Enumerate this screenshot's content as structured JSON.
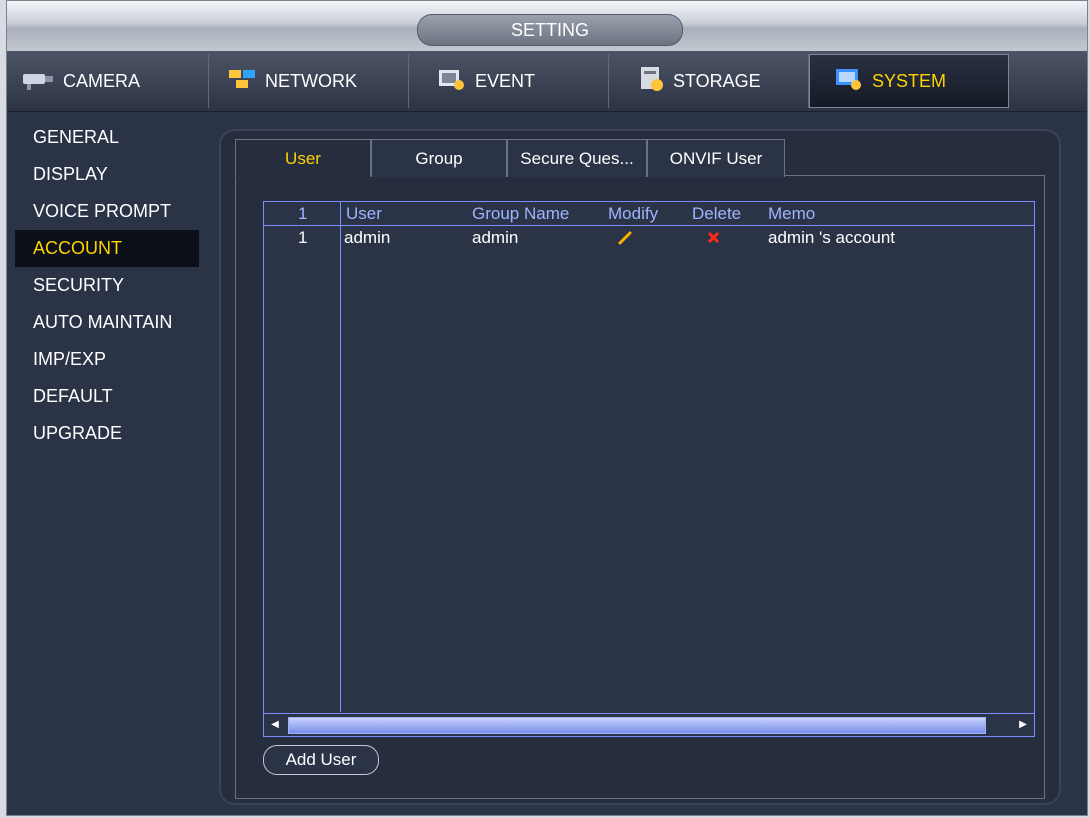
{
  "window": {
    "title": "SETTING"
  },
  "topnav": {
    "tabs": [
      {
        "label": "CAMERA",
        "icon": "camera-icon"
      },
      {
        "label": "NETWORK",
        "icon": "network-icon"
      },
      {
        "label": "EVENT",
        "icon": "event-icon"
      },
      {
        "label": "STORAGE",
        "icon": "storage-icon"
      },
      {
        "label": "SYSTEM",
        "icon": "system-icon"
      }
    ],
    "active": "SYSTEM"
  },
  "sidebar": {
    "items": [
      {
        "label": "GENERAL"
      },
      {
        "label": "DISPLAY"
      },
      {
        "label": "VOICE PROMPT"
      },
      {
        "label": "ACCOUNT"
      },
      {
        "label": "SECURITY"
      },
      {
        "label": "AUTO MAINTAIN"
      },
      {
        "label": "IMP/EXP"
      },
      {
        "label": "DEFAULT"
      },
      {
        "label": "UPGRADE"
      }
    ],
    "active": "ACCOUNT"
  },
  "subtabs": {
    "items": [
      {
        "label": "User"
      },
      {
        "label": "Group"
      },
      {
        "label": "Secure Ques..."
      },
      {
        "label": "ONVIF User"
      }
    ],
    "active": "User"
  },
  "table": {
    "headers": [
      "1",
      "User",
      "Group Name",
      "Modify",
      "Delete",
      "Memo"
    ],
    "rows": [
      {
        "index": "1",
        "user": "admin",
        "group": "admin",
        "modify_icon": "pencil-icon",
        "delete_icon": "x-icon",
        "memo": "admin 's account"
      }
    ]
  },
  "actions": {
    "add_user": "Add User"
  },
  "colors": {
    "accent": "#ffd200",
    "table_border": "#7d8cff",
    "header_text": "#9fb4ff",
    "delete": "#ff2a1a",
    "modify": "#ffb000"
  }
}
